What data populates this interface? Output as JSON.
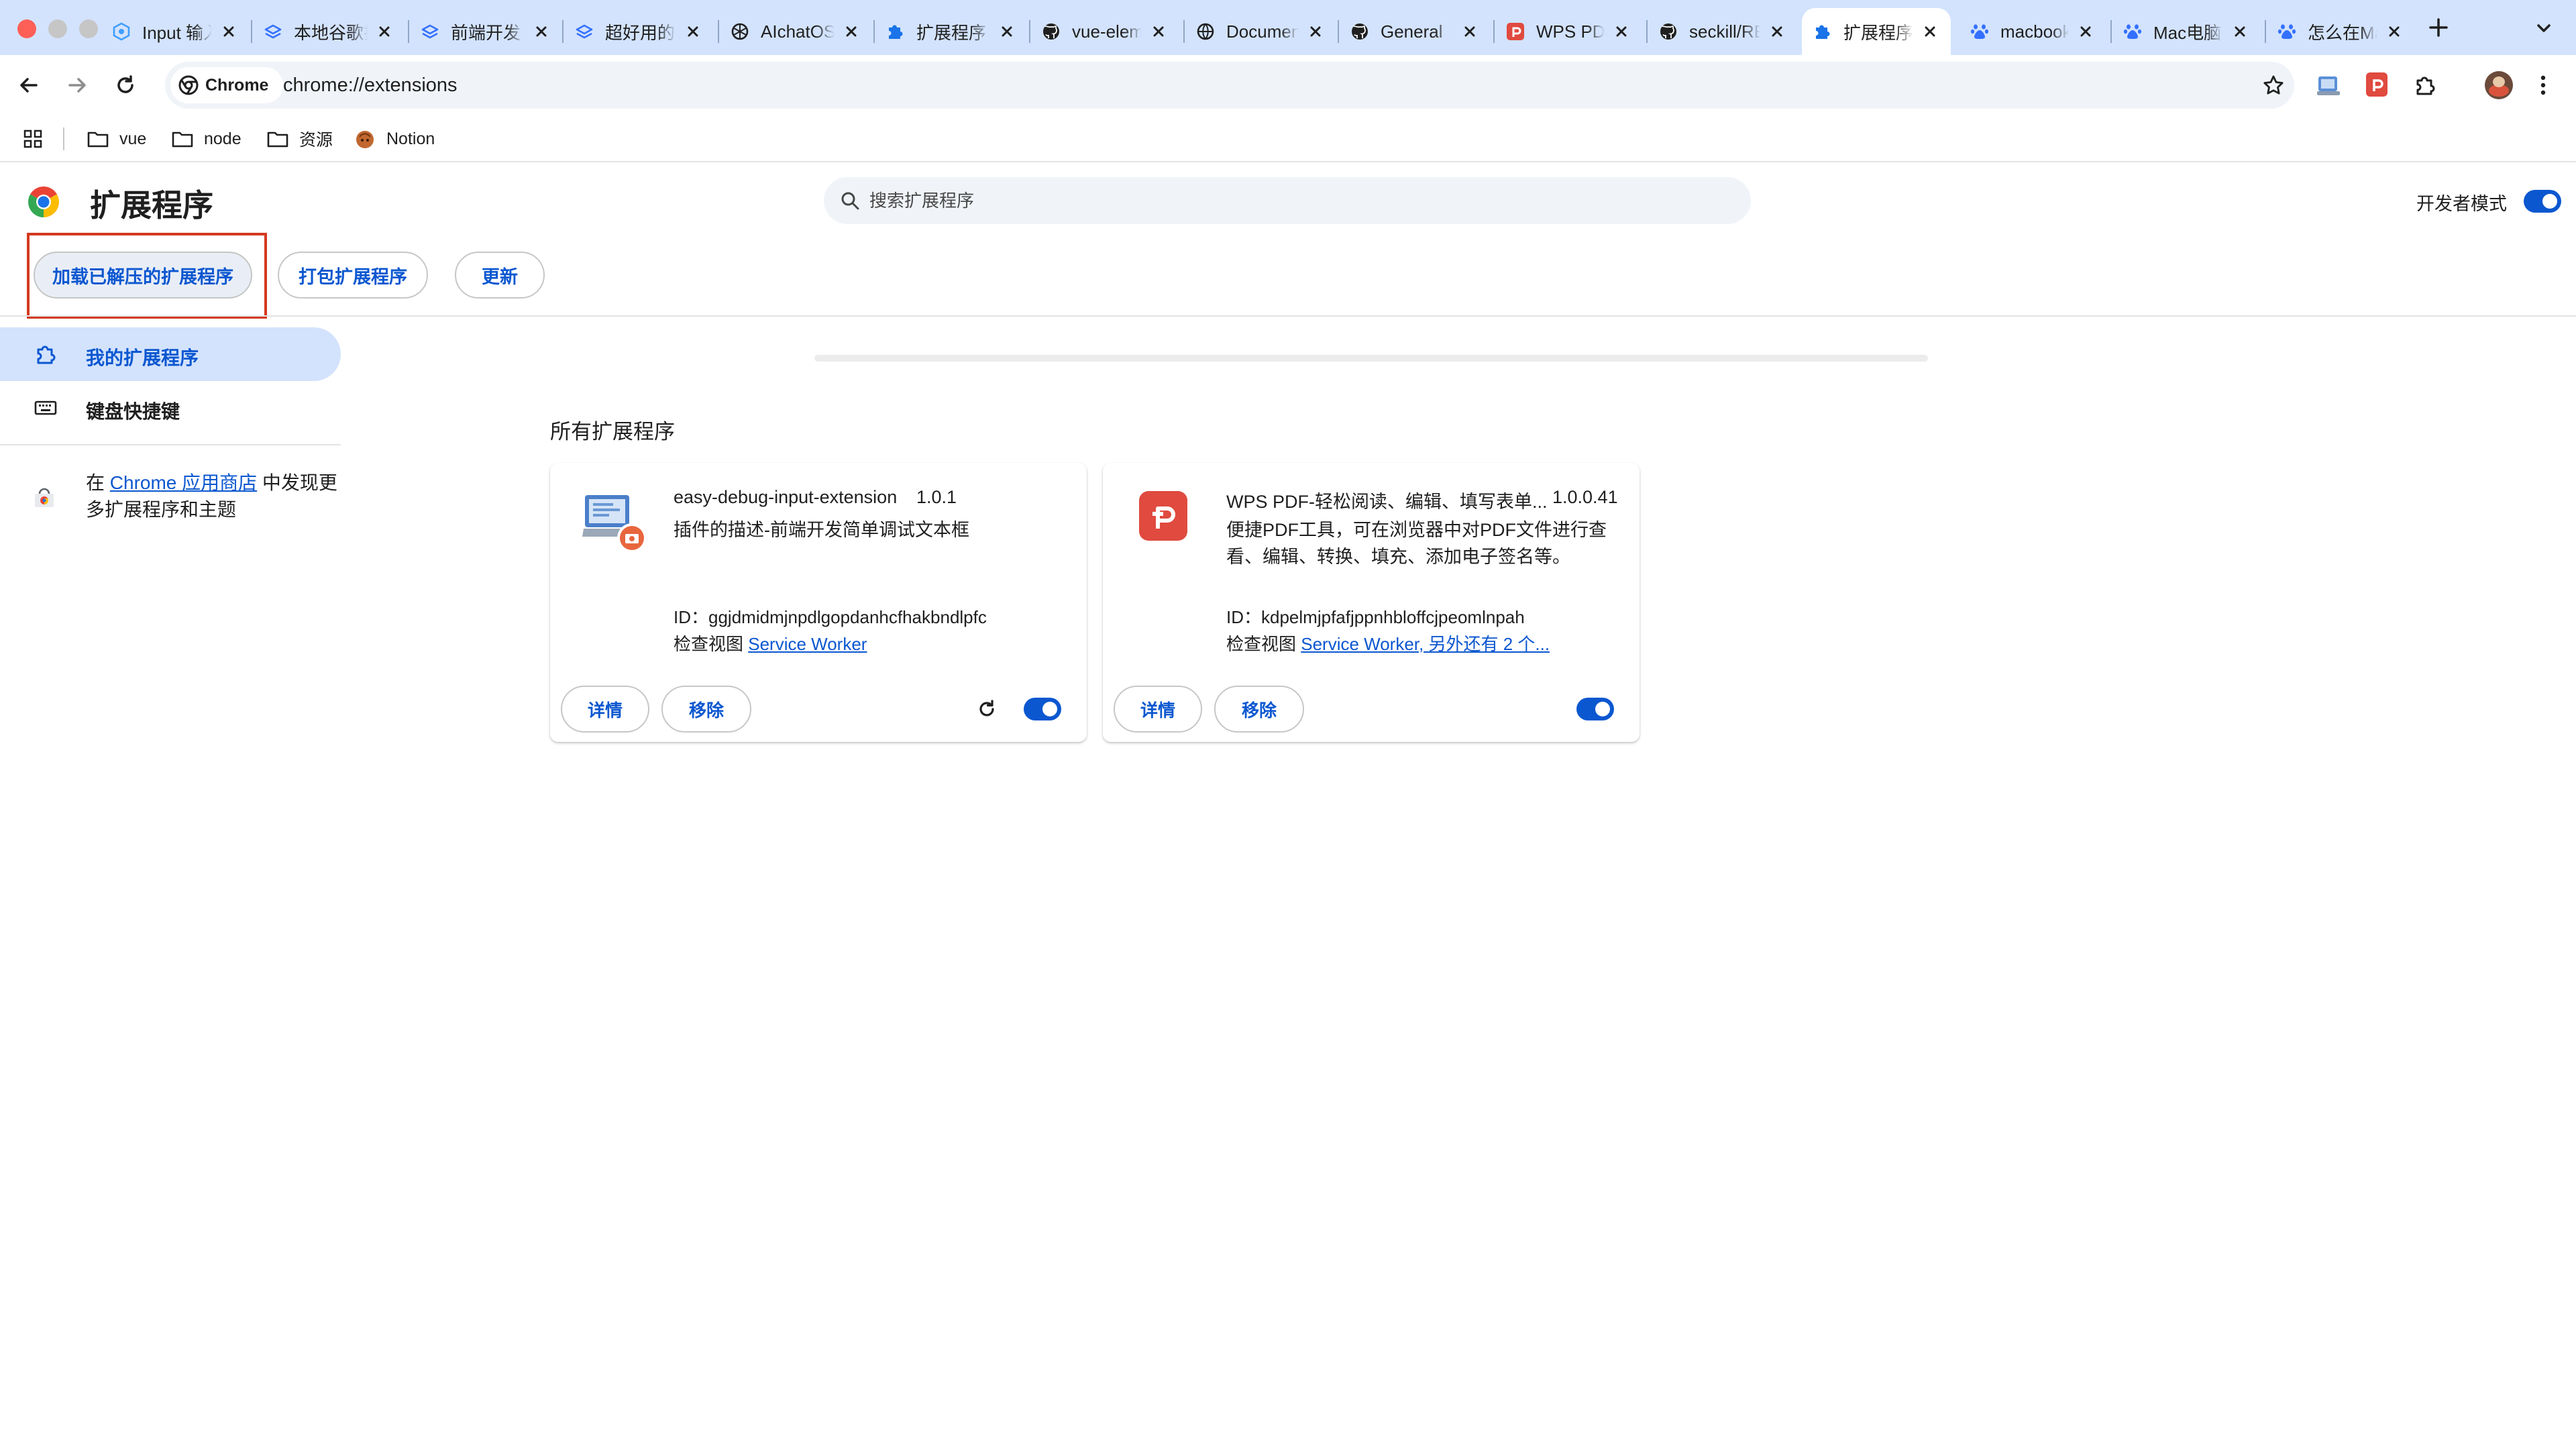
{
  "colors": {
    "tab_strip": "#d3e3fd",
    "accent": "#0b57d0",
    "highlight": "#d4391f",
    "surface": "#f0f4f9"
  },
  "tabs": [
    {
      "title": "Input 输入框",
      "icon": "element-ui-icon"
    },
    {
      "title": "本地谷歌插件",
      "icon": "feishu-doc-icon"
    },
    {
      "title": "前端开发",
      "icon": "feishu-doc-icon"
    },
    {
      "title": "超好用的",
      "icon": "feishu-doc-icon"
    },
    {
      "title": "AIchatOS",
      "icon": "openai-icon"
    },
    {
      "title": "扩展程序",
      "icon": "puzzle-icon"
    },
    {
      "title": "vue-element",
      "icon": "github-icon"
    },
    {
      "title": "Document",
      "icon": "globe-icon"
    },
    {
      "title": "General",
      "icon": "github-icon"
    },
    {
      "title": "WPS PDF",
      "icon": "wps-pdf-icon"
    },
    {
      "title": "seckill/README",
      "icon": "github-icon"
    },
    {
      "title": "扩展程序",
      "icon": "puzzle-icon",
      "active": true
    },
    {
      "title": "macbook",
      "icon": "baidu-icon"
    },
    {
      "title": "Mac电脑",
      "icon": "baidu-icon"
    },
    {
      "title": "怎么在Mac",
      "icon": "baidu-icon"
    }
  ],
  "omnibox": {
    "chip": "Chrome",
    "url": "chrome://extensions"
  },
  "bookmarks": [
    {
      "label": "vue",
      "icon": "folder-icon"
    },
    {
      "label": "node",
      "icon": "folder-icon"
    },
    {
      "label": "资源",
      "icon": "folder-icon"
    },
    {
      "label": "Notion",
      "icon": "notion-icon"
    }
  ],
  "page": {
    "title": "扩展程序",
    "search_placeholder": "搜索扩展程序",
    "developer_mode_label": "开发者模式",
    "developer_mode_on": true,
    "actions": {
      "load_unpacked": "加载已解压的扩展程序",
      "pack": "打包扩展程序",
      "update": "更新"
    },
    "sidebar": {
      "my_extensions": "我的扩展程序",
      "shortcuts": "键盘快捷键"
    },
    "discover": {
      "before": "在 ",
      "link": "Chrome 应用商店",
      "after": " 中发现更多扩展程序和主题"
    },
    "section_title": "所有扩展程序"
  },
  "extensions": [
    {
      "name": "easy-debug-input-extension",
      "version": "1.0.1",
      "description": "插件的描述-前端开发简单调试文本框",
      "id_label": "ID：",
      "id": "ggjdmidmjnpdlgopdanhcfhakbndlpfc",
      "inspect_label": "检查视图 ",
      "inspect_link": "Service Worker",
      "details": "详情",
      "remove": "移除",
      "enabled": true,
      "has_reload": true
    },
    {
      "name": "WPS PDF-轻松阅读、编辑、填写表单...",
      "version": "1.0.0.41",
      "description": "便捷PDF工具，可在浏览器中对PDF文件进行查看、编辑、转换、填充、添加电子签名等。",
      "id_label": "ID：",
      "id": "kdpelmjpfafjppnhbloffcjpeomlnpah",
      "inspect_label": "检查视图 ",
      "inspect_link": "Service Worker, 另外还有 2 个...",
      "details": "详情",
      "remove": "移除",
      "enabled": true,
      "has_reload": false
    }
  ]
}
